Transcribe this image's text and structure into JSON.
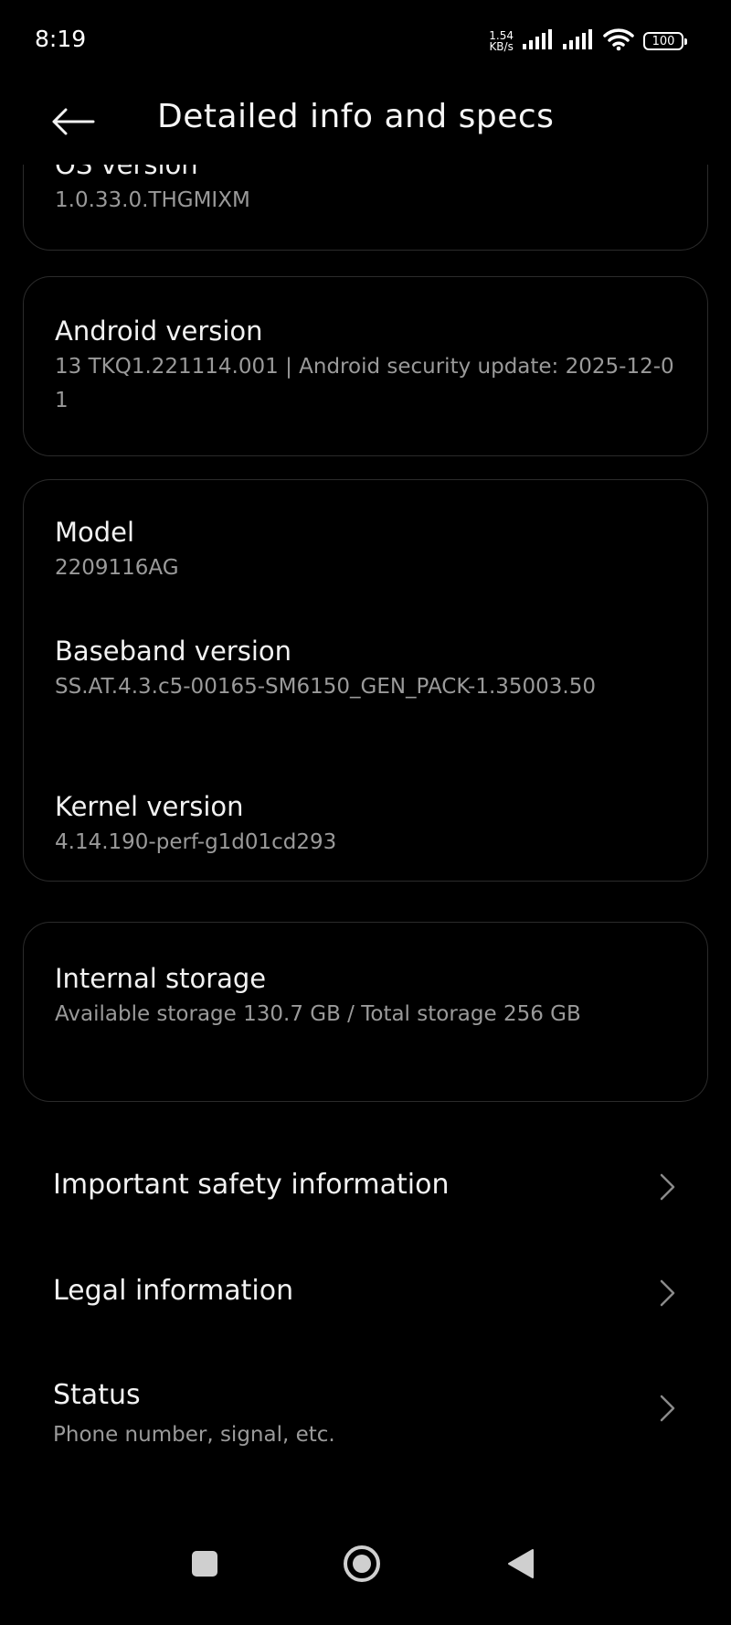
{
  "status_bar": {
    "time": "8:19",
    "net_speed_value": "1.54",
    "net_speed_unit": "KB/s",
    "battery": "100"
  },
  "header": {
    "title": "Detailed info and specs"
  },
  "cards": {
    "os": {
      "label": "OS version",
      "value": "1.0.33.0.THGMIXM"
    },
    "android": {
      "label": "Android version",
      "value": "13 TKQ1.221114.001 | Android security update: 2025-12-01"
    },
    "hardware": {
      "model_label": "Model",
      "model_value": "2209116AG",
      "baseband_label": "Baseband version",
      "baseband_value": "SS.AT.4.3.c5-00165-SM6150_GEN_PACK-1.35003.50",
      "kernel_label": "Kernel version",
      "kernel_value": "4.14.190-perf-g1d01cd293"
    },
    "storage": {
      "label": "Internal storage",
      "value": "Available storage  130.7 GB / Total storage  256 GB"
    }
  },
  "links": {
    "safety": "Important safety information",
    "legal": "Legal information",
    "status_label": "Status",
    "status_sub": "Phone number, signal, etc."
  },
  "icons": {
    "back": "arrow-left-icon",
    "chevron": "chevron-right-icon",
    "recents": "square-icon",
    "home": "circle-icon",
    "back_nav": "triangle-back-icon"
  }
}
